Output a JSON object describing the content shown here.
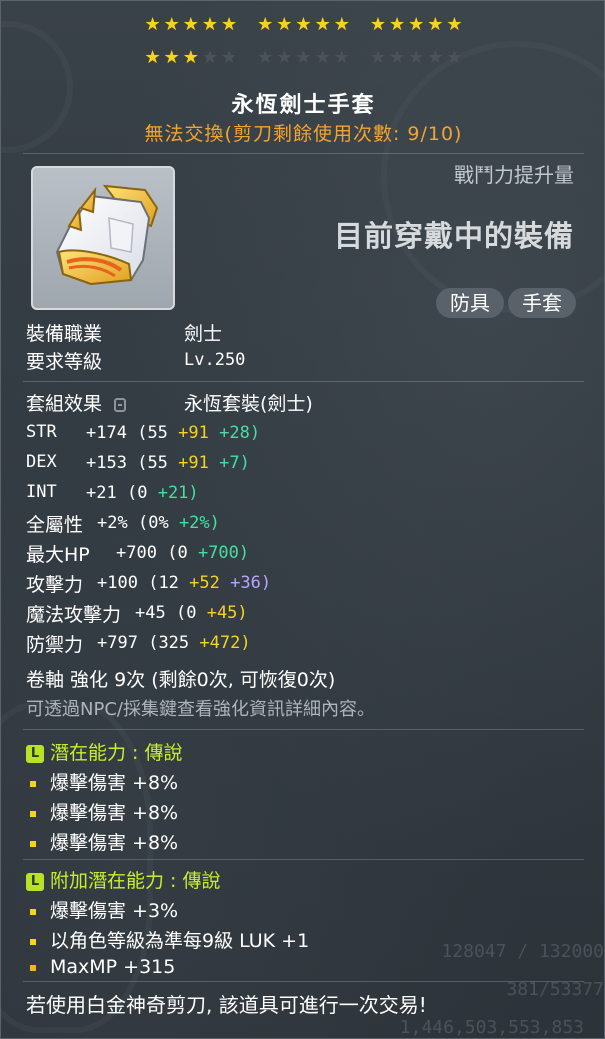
{
  "stars": {
    "row1": [
      [
        1,
        1,
        1,
        1,
        1
      ],
      [
        1,
        1,
        1,
        1,
        1
      ],
      [
        1,
        1,
        1,
        1,
        1
      ]
    ],
    "row2": [
      [
        1,
        1,
        1,
        0,
        0
      ],
      [
        0,
        0,
        0,
        0,
        0
      ],
      [
        0,
        0,
        0,
        0,
        0
      ]
    ],
    "filled_count": 18,
    "total": 30,
    "on_color": "#f6d41e",
    "off_color": "#4d5257"
  },
  "item": {
    "name": "永恆劍士手套",
    "trade_note": "無法交換(剪刀剩餘使用次數: 9/10)",
    "icon": "gauntlet-glove-icon"
  },
  "header_right": {
    "power_label": "戰鬥力提升量",
    "equipped_text": "目前穿戴中的裝備",
    "tags": [
      "防具",
      "手套"
    ]
  },
  "requirements": {
    "job_label": "裝備職業",
    "job_value": "劍士",
    "level_label": "要求等級",
    "level_value": "Lv.250"
  },
  "set_effect": {
    "label": "套組效果",
    "value": "永恆套裝(劍士)"
  },
  "stats": [
    {
      "label": "STR",
      "total": "+174",
      "base": "(55",
      "bonus": "+91",
      "extra": "+28)",
      "extra_color": "green"
    },
    {
      "label": "DEX",
      "total": "+153",
      "base": "(55",
      "bonus": "+91",
      "extra": "+7)",
      "extra_color": "green"
    },
    {
      "label": "INT",
      "total": "+21",
      "base": "(0",
      "bonus": "",
      "extra": "+21)",
      "extra_color": "green"
    },
    {
      "label": "全屬性",
      "total": "+2%",
      "base": "(0%",
      "bonus": "",
      "extra": "+2%)",
      "extra_color": "green"
    },
    {
      "label": "最大HP",
      "total": "+700",
      "base": "(0",
      "bonus": "",
      "extra": "+700)",
      "extra_color": "green"
    },
    {
      "label": "攻擊力",
      "total": "+100",
      "base": "(12",
      "bonus": "+52",
      "extra": "+36)",
      "extra_color": "purple"
    },
    {
      "label": "魔法攻擊力",
      "total": "+45",
      "base": "(0",
      "bonus": "+45)",
      "extra": "",
      "extra_color": "yellow"
    },
    {
      "label": "防禦力",
      "total": "+797",
      "base": "(325",
      "bonus": "+472)",
      "extra": "",
      "extra_color": "yellow"
    }
  ],
  "scroll": {
    "line": "卷軸 強化 9次 (剩餘0次, 可恢復0次)",
    "hint": "可透過NPC/採集鍵查看強化資訊詳細內容。"
  },
  "potential": {
    "badge": "L",
    "title": "潛在能力 : 傳說",
    "lines": [
      "爆擊傷害 +8%",
      "爆擊傷害 +8%",
      "爆擊傷害 +8%"
    ]
  },
  "additional_potential": {
    "badge": "L",
    "title": "附加潛在能力 : 傳說",
    "lines": [
      "爆擊傷害 +3%",
      "以角色等級為準每9級 LUK +1",
      "MaxMP +315"
    ]
  },
  "background_text": [
    "128047 / 132000",
    "381/53377",
    "1,446,503,553,853"
  ],
  "footer": "若使用白金神奇剪刀, 該道具可進行一次交易!"
}
